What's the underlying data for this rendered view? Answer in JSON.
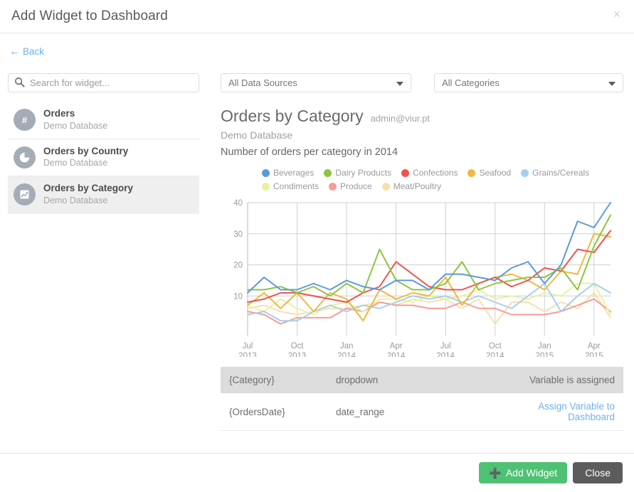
{
  "header": {
    "title": "Add Widget to Dashboard",
    "close_label": "×"
  },
  "back": {
    "label": "Back",
    "icon": "arrow-left-icon"
  },
  "search": {
    "placeholder": "Search for widget...",
    "value": "",
    "icon": "search-icon"
  },
  "widget_list": [
    {
      "name": "Orders",
      "source": "Demo Database",
      "icon": "hash-icon",
      "active": false
    },
    {
      "name": "Orders by Country",
      "source": "Demo Database",
      "icon": "pie-chart-icon",
      "active": false
    },
    {
      "name": "Orders by Category",
      "source": "Demo Database",
      "icon": "line-chart-icon",
      "active": true
    }
  ],
  "filters": {
    "data_source": "All Data Sources",
    "category": "All Categories"
  },
  "preview": {
    "title": "Orders by Category",
    "owner": "admin@viur.pt",
    "database": "Demo Database",
    "description": "Number of orders per category in 2014"
  },
  "variables": {
    "rows": [
      {
        "name": "{Category}",
        "type": "dropdown",
        "status": "Variable is assigned",
        "assigned": true
      },
      {
        "name": "{OrdersDate}",
        "type": "date_range",
        "status": "Assign Variable to Dashboard",
        "assigned": false
      }
    ]
  },
  "footer": {
    "add_label": "Add Widget",
    "add_icon": "plus-icon",
    "close_label": "Close",
    "add_color": "#4fc173",
    "close_color": "#5c5c5c"
  },
  "chart_data": {
    "type": "line",
    "title": "Orders by Category",
    "subtitle": "Number of orders per category in 2014",
    "xlabel": "",
    "ylabel": "",
    "ylim": [
      0,
      40
    ],
    "yticks": [
      10,
      20,
      30,
      40
    ],
    "grid": true,
    "legend_position": "top",
    "x": [
      "Jul 2013",
      "Aug 2013",
      "Sep 2013",
      "Oct 2013",
      "Nov 2013",
      "Dec 2013",
      "Jan 2014",
      "Feb 2014",
      "Mar 2014",
      "Apr 2014",
      "May 2014",
      "Jun 2014",
      "Jul 2014",
      "Aug 2014",
      "Sep 2014",
      "Oct 2014",
      "Nov 2014",
      "Dec 2014",
      "Jan 2015",
      "Feb 2015",
      "Mar 2015",
      "Apr 2015",
      "May 2015"
    ],
    "xticks": [
      {
        "label_top": "Jul",
        "label_bottom": "2013",
        "index": 0
      },
      {
        "label_top": "Oct",
        "label_bottom": "2013",
        "index": 3
      },
      {
        "label_top": "Jan",
        "label_bottom": "2014",
        "index": 6
      },
      {
        "label_top": "Apr",
        "label_bottom": "2014",
        "index": 9
      },
      {
        "label_top": "Jul",
        "label_bottom": "2014",
        "index": 12
      },
      {
        "label_top": "Oct",
        "label_bottom": "2014",
        "index": 15
      },
      {
        "label_top": "Jan",
        "label_bottom": "2015",
        "index": 18
      },
      {
        "label_top": "Apr",
        "label_bottom": "2015",
        "index": 21
      }
    ],
    "series": [
      {
        "name": "Beverages",
        "color": "#5b9bd5",
        "values": [
          11,
          16,
          12,
          12,
          14,
          12,
          15,
          13,
          12,
          15,
          15,
          12,
          17,
          17,
          16,
          15,
          19,
          21,
          14,
          20,
          34,
          32,
          40
        ]
      },
      {
        "name": "Dairy Products",
        "color": "#8cc63e",
        "values": [
          12,
          12,
          13,
          11,
          13,
          10,
          14,
          11,
          25,
          15,
          12,
          12,
          14,
          21,
          12,
          14,
          15,
          16,
          16,
          19,
          12,
          26,
          36
        ]
      },
      {
        "name": "Confections",
        "color": "#f0524a",
        "values": [
          8,
          9,
          11,
          11,
          10,
          9,
          8,
          11,
          13,
          21,
          17,
          13,
          12,
          12,
          14,
          16,
          13,
          15,
          19,
          18,
          25,
          24,
          31
        ]
      },
      {
        "name": "Seafood",
        "color": "#f0b840",
        "values": [
          7,
          11,
          6,
          11,
          5,
          11,
          9,
          2,
          12,
          9,
          11,
          10,
          16,
          7,
          14,
          16,
          17,
          15,
          12,
          18,
          17,
          30,
          29
        ]
      },
      {
        "name": "Grains/Cereals",
        "color": "#a8cdf0",
        "values": [
          4,
          5,
          2,
          2,
          5,
          7,
          5,
          7,
          6,
          8,
          10,
          9,
          10,
          8,
          10,
          8,
          6,
          10,
          14,
          5,
          10,
          14,
          11
        ]
      },
      {
        "name": "Condiments",
        "color": "#e6f4a0",
        "values": [
          7,
          5,
          9,
          6,
          4,
          7,
          8,
          5,
          9,
          9,
          8,
          10,
          9,
          10,
          12,
          9,
          10,
          9,
          11,
          10,
          14,
          14,
          4
        ]
      },
      {
        "name": "Produce",
        "color": "#f79c96",
        "values": [
          5,
          4,
          1,
          3,
          3,
          3,
          6,
          5,
          8,
          7,
          7,
          6,
          6,
          8,
          6,
          6,
          4,
          4,
          4,
          5,
          7,
          9,
          5
        ]
      },
      {
        "name": "Meat/Poultry",
        "color": "#fbdfac",
        "values": [
          6,
          7,
          5,
          4,
          5,
          6,
          6,
          7,
          8,
          7,
          9,
          8,
          9,
          6,
          9,
          1,
          8,
          8,
          5,
          8,
          6,
          11,
          3
        ]
      }
    ]
  }
}
